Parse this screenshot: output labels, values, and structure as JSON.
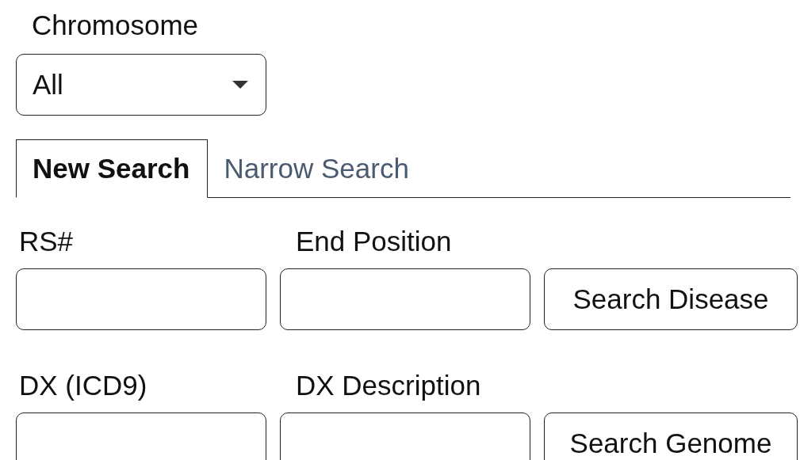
{
  "chromosome": {
    "label": "Chromosome",
    "value": "All"
  },
  "tabs": [
    {
      "label": "New Search",
      "selected": true
    },
    {
      "label": "Narrow Search",
      "selected": false
    }
  ],
  "rows": [
    {
      "fields": [
        {
          "label": "RS#"
        },
        {
          "label": "End Position"
        }
      ],
      "button": "Search Disease"
    },
    {
      "fields": [
        {
          "label": "DX (ICD9)"
        },
        {
          "label": "DX Description"
        }
      ],
      "button": "Search Genome"
    }
  ]
}
